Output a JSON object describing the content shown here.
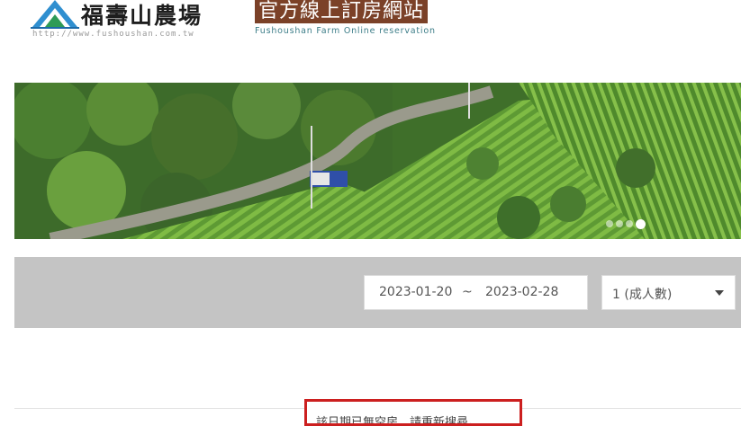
{
  "header": {
    "logo_name": "福壽山農場",
    "logo_url": "http://www.fushoushan.com.tw",
    "title": "官方線上訂房網站",
    "subtitle": "Fushoushan Farm Online reservation"
  },
  "banner": {
    "image": "tea-plantation-photo",
    "slide_count": 4,
    "active_slide": 4
  },
  "search": {
    "check_in": "2023-01-20",
    "separator": "~",
    "check_out": "2023-02-28",
    "guests": "1 (成人數)"
  },
  "notice": {
    "message": "該日期已無空房，請重新搜尋。"
  },
  "colors": {
    "title_bg": "#7b4128",
    "search_bar_bg": "#c4c4c4",
    "notice_border": "#cc1f1f",
    "subtitle_text": "#3c7d88"
  }
}
